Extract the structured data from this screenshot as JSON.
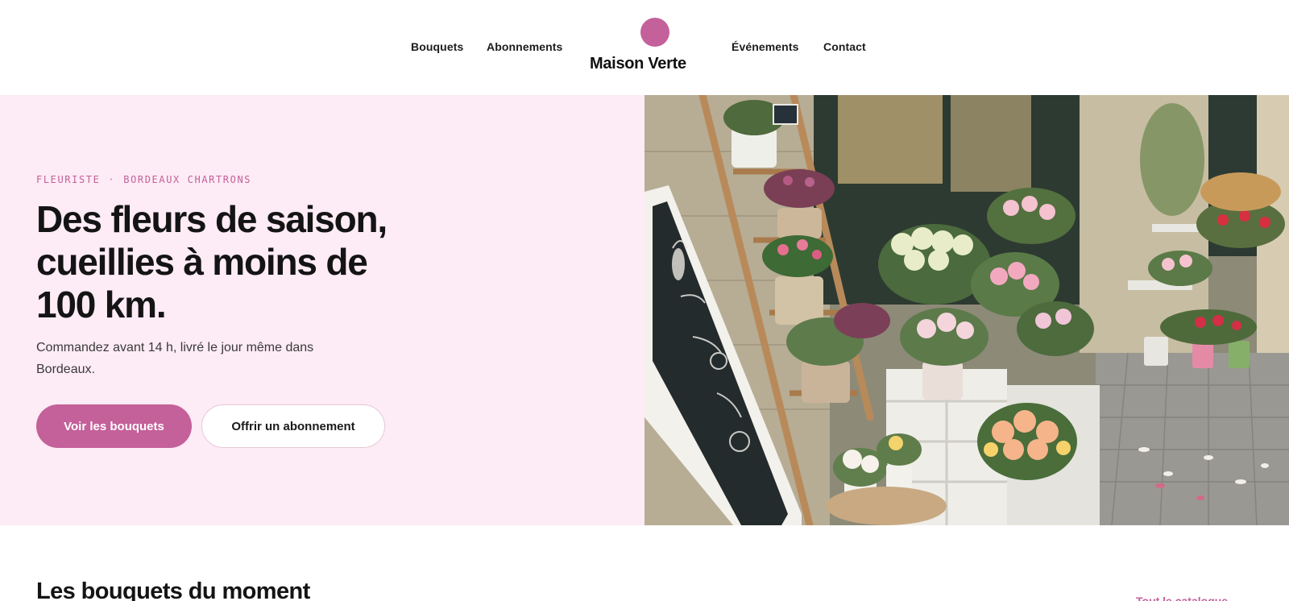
{
  "brand": {
    "name": "Maison Verte",
    "accent": "#c4609a",
    "hero_bg": "#fdebf5"
  },
  "nav": {
    "left": [
      "Bouquets",
      "Abonnements"
    ],
    "right": [
      "Événements",
      "Contact"
    ]
  },
  "hero": {
    "eyebrow": [
      "FLEURISTE",
      "·",
      "BORDEAUX CHARTRONS"
    ],
    "title": "Des fleurs de saison, cueillies à moins de 100 km.",
    "subtitle": "Commandez avant 14 h, livré le jour même dans Bordeaux.",
    "primary_cta": "Voir les bouquets",
    "secondary_cta": "Offrir un abonnement",
    "image_icon": "flower-shop-photo"
  },
  "section": {
    "title": "Les bouquets du moment",
    "link": "Tout le catalogue →"
  }
}
